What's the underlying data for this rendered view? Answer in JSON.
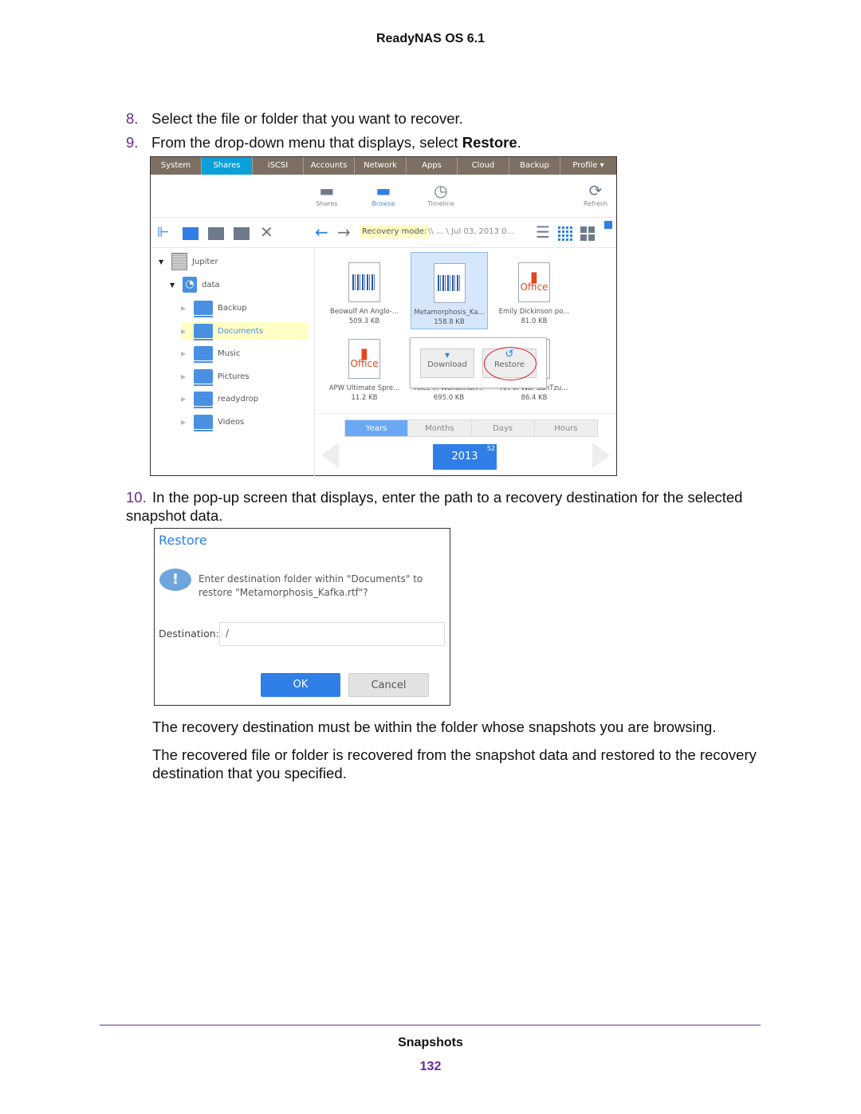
{
  "header": "ReadyNAS OS 6.1",
  "steps": [
    {
      "num": "8.",
      "text": "Select the file or folder that you want to recover."
    },
    {
      "num": "9.",
      "text_before": "From the drop-down menu that displays, select ",
      "bold": "Restore",
      "text_after": "."
    },
    {
      "num": "10.",
      "text": "In the pop-up screen that displays, enter the path to a recovery destination for the selected snapshot data."
    }
  ],
  "screenshot": {
    "nav_tabs": [
      "System",
      "Shares",
      "iSCSI",
      "Accounts",
      "Network",
      "Apps",
      "Cloud",
      "Backup",
      "Profile ▾"
    ],
    "active_tab": "Shares",
    "toolbar": {
      "shares": "Shares",
      "browse": "Browse",
      "timeline": "Timeline",
      "refresh": "Refresh"
    },
    "recovery_label": "Recovery mode:",
    "path": "\\\\ ... \\ Jul 03, 2013 0...",
    "tree": {
      "root": "Jupiter",
      "volume": "data",
      "shares": [
        "Backup",
        "Documents",
        "Music",
        "Pictures",
        "readydrop",
        "Videos"
      ],
      "selected": "Documents"
    },
    "files": [
      {
        "name": "Beowulf An Anglo-...",
        "size": "509.3 KB",
        "type": "rtf"
      },
      {
        "name": "Metamorphosis_Ka...",
        "size": "158.8 KB",
        "type": "rtf",
        "selected": true
      },
      {
        "name": "Emily Dickinson po...",
        "size": "81.0 KB",
        "type": "office"
      },
      {
        "name": "APW Ultimate Spre...",
        "size": "11.2 KB",
        "type": "office"
      },
      {
        "name": "Alice in Wonderlan...",
        "size": "695.0 KB",
        "type": "rtf"
      },
      {
        "name": "Art of War SunTzu...",
        "size": "86.4 KB",
        "type": "rtf"
      }
    ],
    "office_label": "Office",
    "popup": {
      "download": "Download",
      "restore": "Restore"
    },
    "periods": [
      "Years",
      "Months",
      "Days",
      "Hours"
    ],
    "active_period": "Years",
    "year": "2013",
    "year_count": "52",
    "accent": "#0aa0d8"
  },
  "dialog": {
    "title": "Restore",
    "message_line1": "Enter destination folder within \"Documents\" to",
    "message_line2": "restore \"Metamorphosis_Kafka.rtf\"?",
    "destination_label": "Destination:",
    "destination_value": "/",
    "ok": "OK",
    "cancel": "Cancel"
  },
  "paragraphs": [
    "The recovery destination must be within the folder whose snapshots you are browsing.",
    "The recovered file or folder is recovered from the snapshot data and restored to the recovery destination that you specified."
  ],
  "footer": {
    "section": "Snapshots",
    "page": "132"
  }
}
